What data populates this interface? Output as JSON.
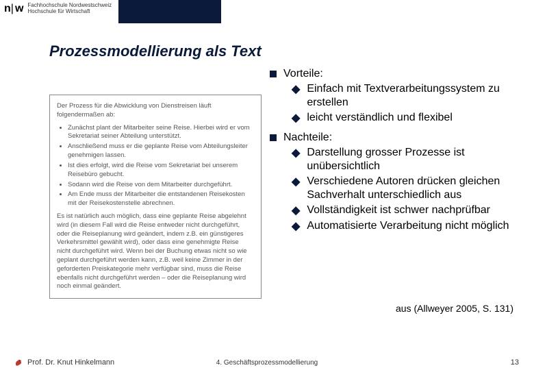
{
  "logo": {
    "mark_prefix": "n",
    "mark_suffix": "w",
    "text_line1": "Fachhochschule Nordwestschweiz",
    "text_line2": "Hochschule für Wirtschaft"
  },
  "title": "Prozessmodellierung als Text",
  "example": {
    "intro": "Der Prozess für die Abwicklung von Dienstreisen läuft folgendermaßen ab:",
    "items": [
      "Zunächst plant der Mitarbeiter seine Reise. Hierbei wird er vom Sekretariat seiner Abteilung unterstützt.",
      "Anschließend muss er die geplante Reise vom Abteilungsleiter genehmigen lassen.",
      "Ist dies erfolgt, wird die Reise vom Sekretariat bei unserem Reisebüro gebucht.",
      "Sodann wird die Reise von dem Mitarbeiter durchgeführt.",
      "Am Ende muss der Mitarbeiter die entstandenen Reisekosten mit der Reisekostenstelle abrechnen."
    ],
    "para": "Es ist natürlich auch möglich, dass eine geplante Reise abgelehnt wird (in diesem Fall wird die Reise entweder nicht durchgeführt, oder die Reiseplanung wird geändert, indem z.B. ein günstigeres Verkehrsmittel gewählt wird), oder dass eine genehmigte Reise nicht durchgeführt wird. Wenn bei der Buchung etwas nicht so wie geplant durchgeführt werden kann, z.B. weil keine Zimmer in der geforderten Preiskategorie mehr verfügbar sind, muss die Reise ebenfalls nicht durchgeführt werden – oder die Reiseplanung wird noch einmal geändert."
  },
  "bullets": {
    "vorteile": {
      "label": "Vorteile:",
      "items": [
        "Einfach mit Textverarbeitungssystem zu erstellen",
        "leicht verständlich und flexibel"
      ]
    },
    "nachteile": {
      "label": "Nachteile:",
      "items": [
        "Darstellung grosser Prozesse ist unübersichtlich",
        "Verschiedene Autoren drücken gleichen Sachverhalt unterschiedlich aus",
        "Vollständigkeit ist schwer nachprüfbar",
        "Automatisierte Verarbeitung nicht möglich"
      ]
    }
  },
  "citation": "aus (Allweyer 2005, S. 131)",
  "footer": {
    "author": "Prof. Dr. Knut Hinkelmann",
    "chapter": "4. Geschäftsprozessmodellierung",
    "page": "13"
  }
}
